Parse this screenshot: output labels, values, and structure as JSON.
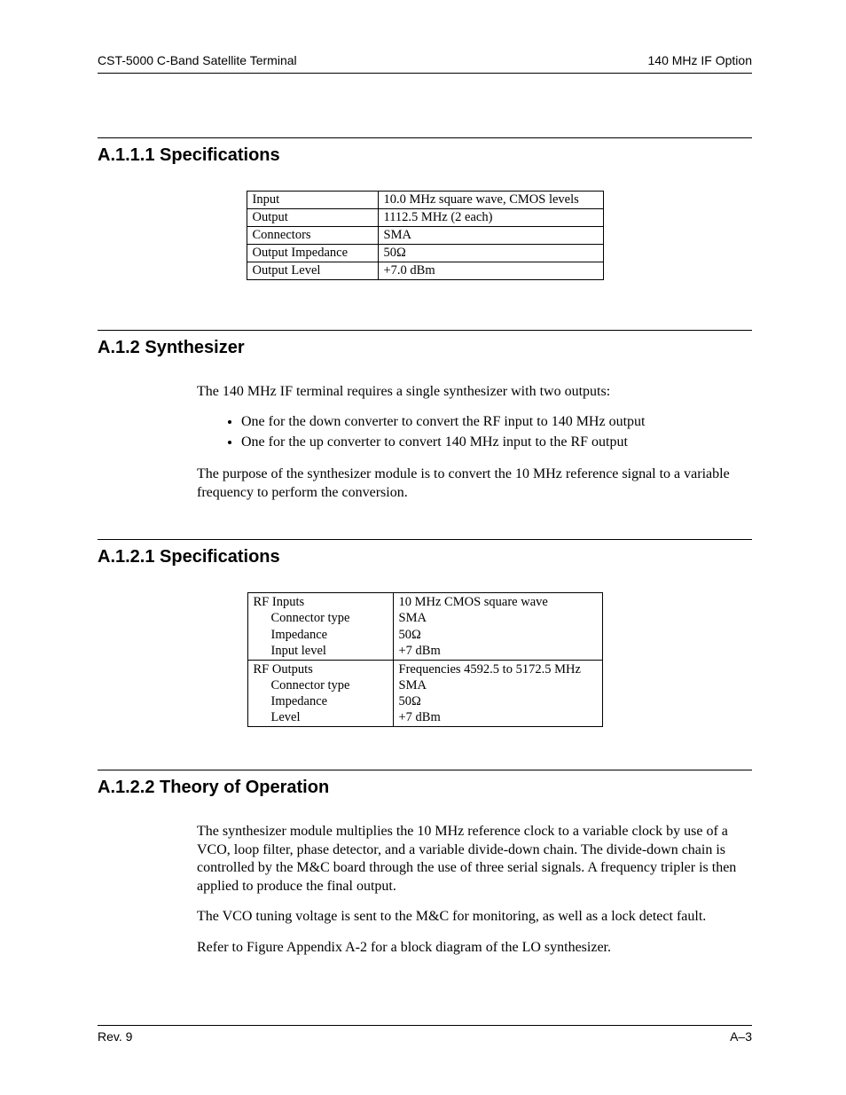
{
  "header": {
    "left": "CST-5000 C-Band Satellite Terminal",
    "right": "140 MHz IF Option"
  },
  "sections": {
    "a111": {
      "heading": "A.1.1.1  Specifications",
      "table": {
        "rows": [
          {
            "label": "Input",
            "value": "10.0 MHz square wave, CMOS levels"
          },
          {
            "label": "Output",
            "value": "1112.5 MHz (2 each)"
          },
          {
            "label": "Connectors",
            "value": "SMA"
          },
          {
            "label": "Output Impedance",
            "value": "50Ω"
          },
          {
            "label": "Output Level",
            "value": "+7.0 dBm"
          }
        ]
      }
    },
    "a12": {
      "heading": "A.1.2  Synthesizer",
      "intro": "The 140 MHz IF terminal requires a single synthesizer with two outputs:",
      "bullets": [
        "One for the down converter to convert the RF input to 140 MHz output",
        "One for the up converter to convert 140 MHz input to the RF output"
      ],
      "outro": "The purpose of the synthesizer module is to convert the 10 MHz reference signal to a variable frequency to perform the conversion."
    },
    "a121": {
      "heading": "A.1.2.1  Specifications",
      "table2": {
        "group1": {
          "title": "RF Inputs",
          "sub": [
            {
              "label": "Connector type",
              "value": "SMA"
            },
            {
              "label": "Impedance",
              "value": "50Ω"
            },
            {
              "label": "Input level",
              "value": "+7 dBm"
            }
          ],
          "title_value": "10 MHz CMOS square wave"
        },
        "group2": {
          "title": "RF Outputs",
          "sub": [
            {
              "label": "Connector type",
              "value": "SMA"
            },
            {
              "label": "Impedance",
              "value": "50Ω"
            },
            {
              "label": "Level",
              "value": "+7 dBm"
            }
          ],
          "title_value": "Frequencies 4592.5 to 5172.5 MHz"
        }
      }
    },
    "a122": {
      "heading": "A.1.2.2  Theory of Operation",
      "p1": "The synthesizer module multiplies the 10 MHz reference clock to a variable clock by use of a VCO, loop filter, phase detector, and a variable divide-down chain. The divide-down chain is controlled by the M&C board through the use of three serial signals. A frequency tripler is then applied to produce the final output.",
      "p2": "The VCO tuning voltage is sent to the M&C for monitoring, as well as a lock detect fault.",
      "p3": "Refer to Figure Appendix A-2 for a block diagram of the LO synthesizer."
    }
  },
  "footer": {
    "left": "Rev. 9",
    "right": "A–3"
  }
}
